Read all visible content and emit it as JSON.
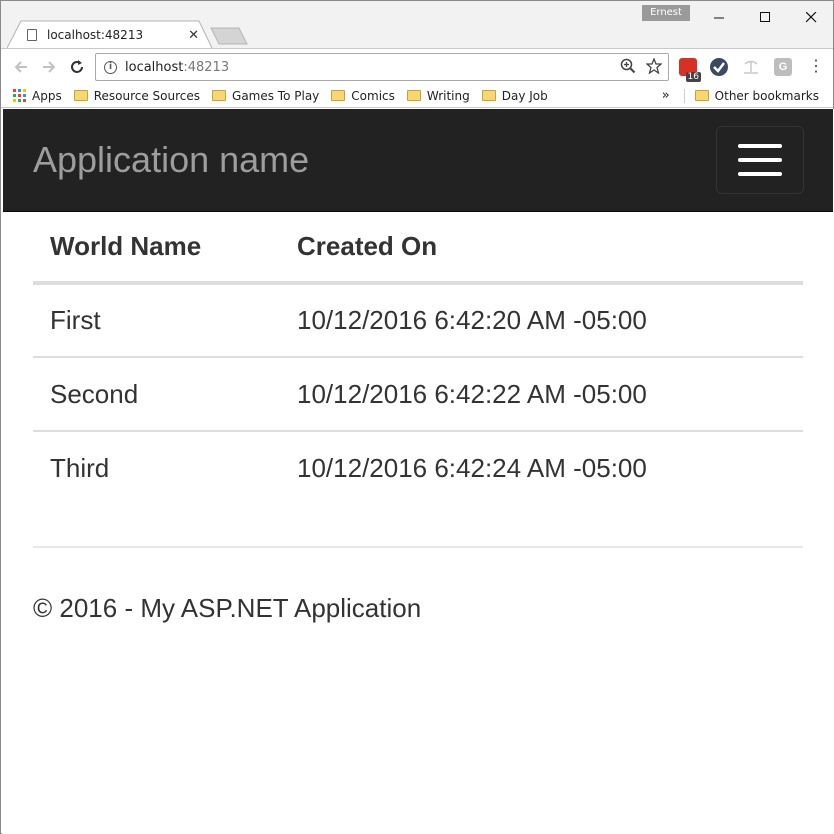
{
  "browser": {
    "user_name": "Ernest",
    "tab_title": "localhost:48213",
    "url_host": "localhost",
    "url_port": ":48213",
    "ext_badge": "16",
    "bookmarks": [
      {
        "label": "Apps",
        "icon": "apps-grid-icon"
      },
      {
        "label": "Resource Sources",
        "icon": "folder-icon"
      },
      {
        "label": "Games To Play",
        "icon": "folder-icon"
      },
      {
        "label": "Comics",
        "icon": "folder-icon"
      },
      {
        "label": "Writing",
        "icon": "folder-icon"
      },
      {
        "label": "Day Job",
        "icon": "folder-icon"
      }
    ],
    "overflow_chevron": "»",
    "other_bookmarks": "Other bookmarks"
  },
  "app": {
    "brand": "Application name",
    "table": {
      "headers": [
        "World Name",
        "Created On"
      ],
      "rows": [
        [
          "First",
          "10/12/2016 6:42:20 AM -05:00"
        ],
        [
          "Second",
          "10/12/2016 6:42:22 AM -05:00"
        ],
        [
          "Third",
          "10/12/2016 6:42:24 AM -05:00"
        ]
      ]
    },
    "footer": "© 2016 - My ASP.NET Application"
  },
  "colors": {
    "navbar_bg": "#222222",
    "brand_text": "#9d9d9d",
    "body_text": "#333333"
  }
}
